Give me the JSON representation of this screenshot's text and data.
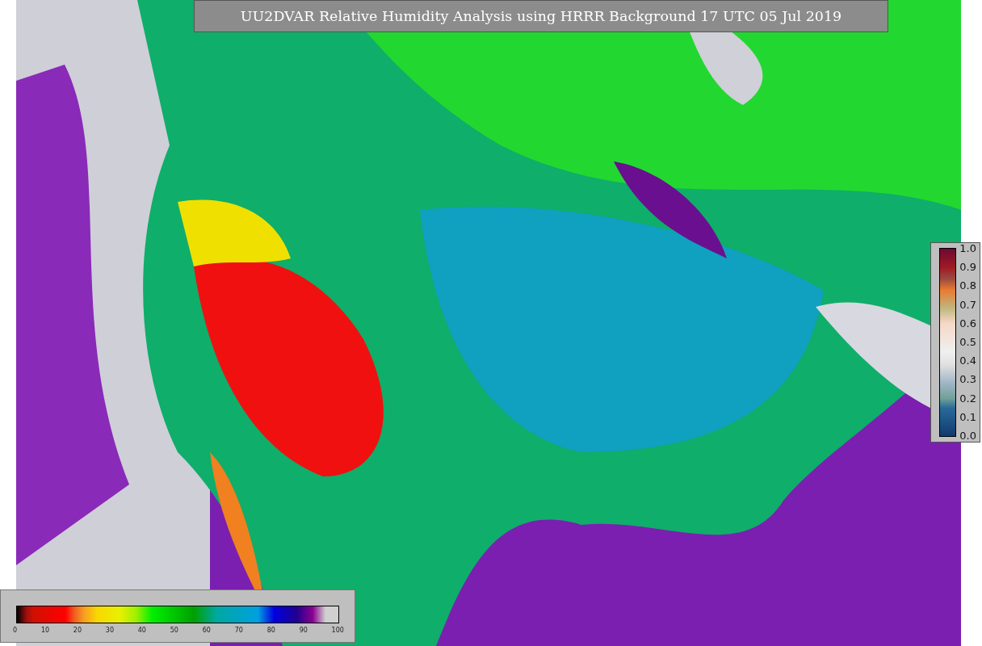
{
  "title": "UU2DVAR Relative Humidity Analysis using HRRR Background 17 UTC 05 Jul 2019",
  "humidity_colorbar": {
    "ticks": [
      "0",
      "10",
      "20",
      "30",
      "40",
      "50",
      "60",
      "70",
      "80",
      "90",
      "100"
    ]
  },
  "fraction_colorbar": {
    "ticks": [
      "1.0",
      "0.9",
      "0.8",
      "0.7",
      "0.6",
      "0.5",
      "0.4",
      "0.3",
      "0.2",
      "0.1",
      "0.0"
    ]
  }
}
